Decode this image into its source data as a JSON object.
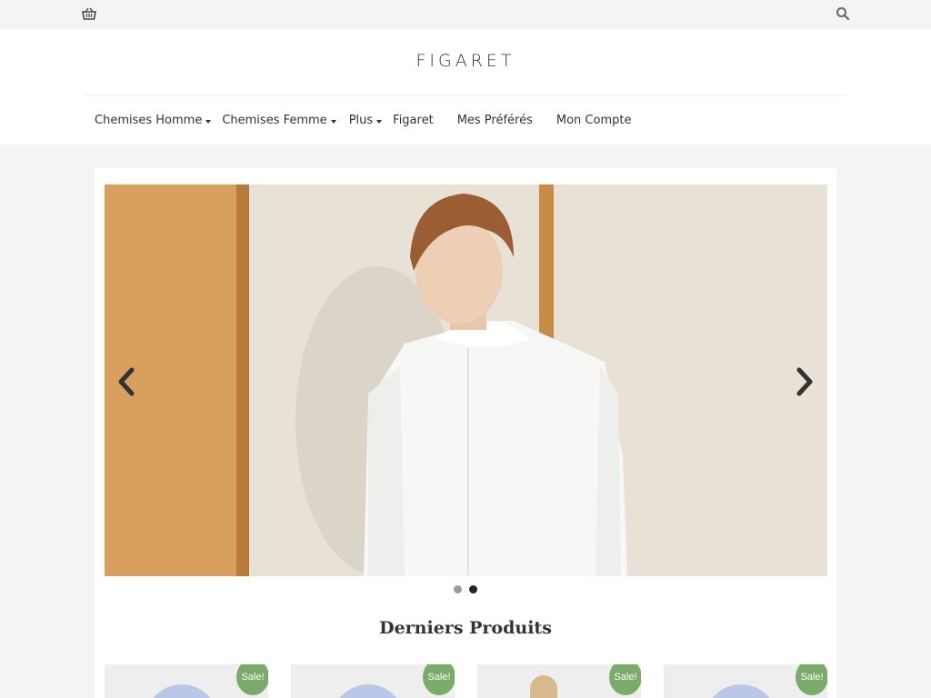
{
  "header": {
    "logo": "FIGARET"
  },
  "icons": {
    "cart": "shopping-basket-icon",
    "search": "search-icon"
  },
  "nav": {
    "items": [
      {
        "label": "Chemises Homme",
        "has_dropdown": true
      },
      {
        "label": "Chemises Femme",
        "has_dropdown": true
      },
      {
        "label": "Plus",
        "has_dropdown": true
      },
      {
        "label": "Figaret",
        "has_dropdown": false
      },
      {
        "label": "Mes Préférés",
        "has_dropdown": false
      },
      {
        "label": "Mon Compte",
        "has_dropdown": false
      }
    ]
  },
  "slider": {
    "slide_count": 2,
    "active_slide": 2
  },
  "section": {
    "title": "Derniers Produits"
  },
  "products": [
    {
      "badge": "Sale!"
    },
    {
      "badge": "Sale!"
    },
    {
      "badge": "Sale!"
    },
    {
      "badge": "Sale!"
    }
  ],
  "colors": {
    "sale_badge": "#7aab6a",
    "page_bg": "#f4f4f4",
    "text": "#333333"
  }
}
